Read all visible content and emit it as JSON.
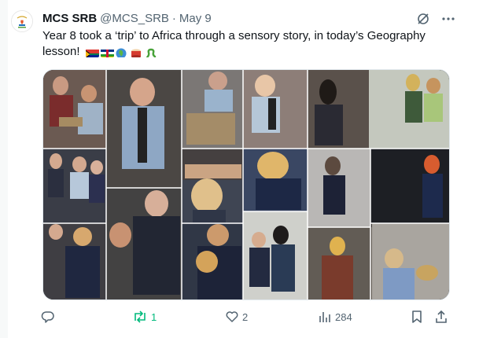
{
  "author": {
    "name": "MCS SRB",
    "handle": "@MCS_SRB",
    "separator": "·",
    "date": "May 9"
  },
  "icons": {
    "grok": "grok-icon",
    "more": "more-icon",
    "reply": "reply-icon",
    "retweet": "retweet-icon",
    "like": "like-icon",
    "views": "views-icon",
    "bookmark": "bookmark-icon",
    "share": "share-icon"
  },
  "tweet": {
    "text": "Year 8 took a ‘trip’ to Africa through a sensory story, in today’s Geography lesson!",
    "emoji": [
      "south-africa-flag",
      "central-african-republic-flag",
      "globe-africa-emoji",
      "drum-emoji",
      "snake-emoji"
    ]
  },
  "stats": {
    "replies": "",
    "retweets": "1",
    "likes": "2",
    "views": "284"
  },
  "colors": {
    "retweet_active": "#00ba7c",
    "muted": "#536471",
    "text": "#0f1419"
  }
}
